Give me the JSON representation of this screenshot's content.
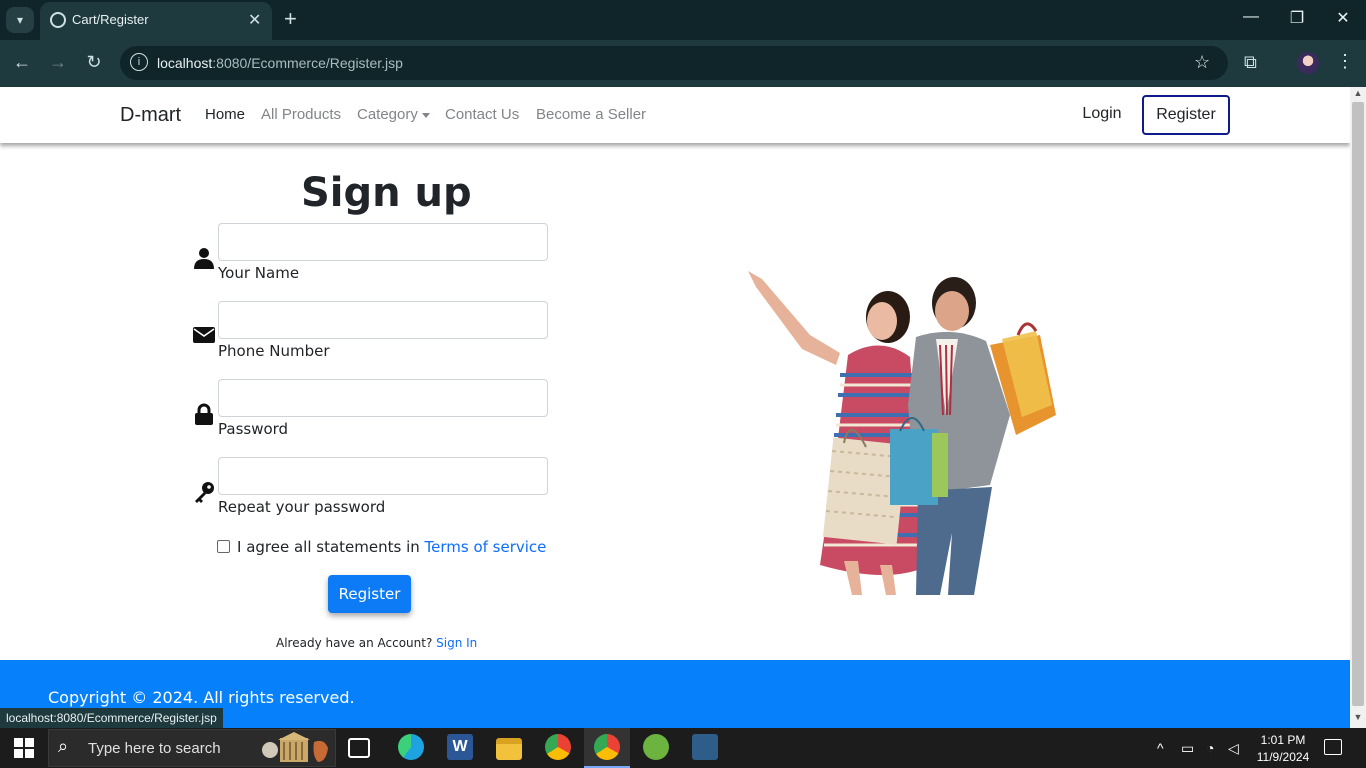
{
  "browser": {
    "tab_title": "Cart/Register",
    "url_host": "localhost",
    "url_rest": ":8080/Ecommerce/Register.jsp",
    "status_url": "localhost:8080/Ecommerce/Register.jsp"
  },
  "navbar": {
    "brand": "D-mart",
    "links": [
      "Home",
      "All Products",
      "Category",
      "Contact Us",
      "Become a Seller"
    ],
    "login": "Login",
    "register": "Register"
  },
  "form": {
    "title": "Sign up",
    "fields": [
      {
        "label": "Your Name",
        "icon": "user-icon",
        "value": ""
      },
      {
        "label": "Phone Number",
        "icon": "envelope-icon",
        "value": ""
      },
      {
        "label": "Password",
        "icon": "lock-icon",
        "value": ""
      },
      {
        "label": "Repeat your password",
        "icon": "key-icon",
        "value": ""
      }
    ],
    "agree_text": "I agree all statements in ",
    "terms_link": "Terms of service",
    "terms_checked": false,
    "submit": "Register",
    "already_text": "Already have an Account? ",
    "signin_link": "Sign In"
  },
  "footer": {
    "copyright": "Copyright © 2024. All rights reserved."
  },
  "taskbar": {
    "search_placeholder": "Type here to search",
    "time": "1:01 PM",
    "date": "11/9/2024"
  },
  "colors": {
    "primary": "#0680fb",
    "link": "#0d6efd",
    "chrome_dark": "#0f2529"
  }
}
